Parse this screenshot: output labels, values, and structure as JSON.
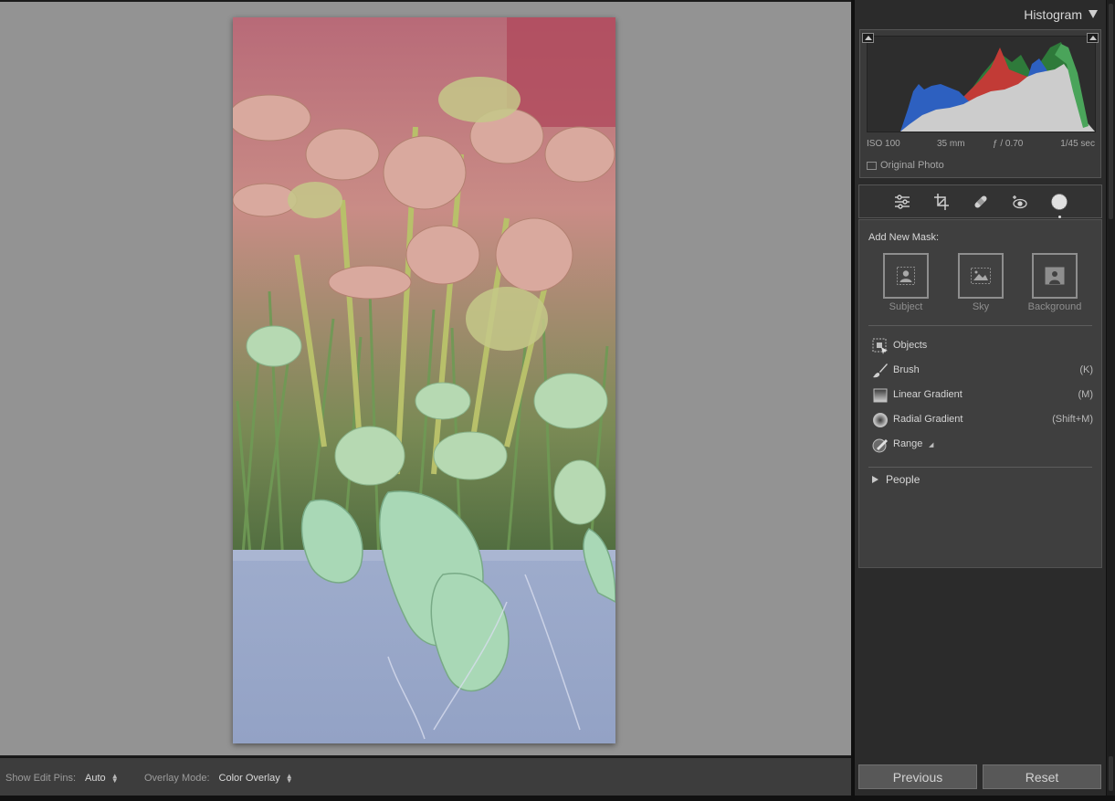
{
  "histogram": {
    "title": "Histogram",
    "exif": {
      "iso": "ISO 100",
      "focal": "35 mm",
      "aperture": "ƒ / 0.70",
      "shutter": "1/45 sec"
    },
    "original_photo_label": "Original Photo",
    "colors": {
      "red": "#d34a3c",
      "green": "#3c9a4a",
      "blue": "#2e63c2",
      "luma": "#c9c9c9"
    }
  },
  "tools": [
    {
      "name": "edit-sliders-icon"
    },
    {
      "name": "crop-icon"
    },
    {
      "name": "healing-icon"
    },
    {
      "name": "red-eye-icon"
    },
    {
      "name": "masking-icon",
      "active": true
    }
  ],
  "masking": {
    "add_label": "Add New Mask:",
    "quick": [
      {
        "label": "Subject",
        "icon": "subject-icon"
      },
      {
        "label": "Sky",
        "icon": "sky-icon"
      },
      {
        "label": "Background",
        "icon": "background-icon"
      }
    ],
    "tools": [
      {
        "label": "Objects",
        "shortcut": "",
        "icon": "objects-icon"
      },
      {
        "label": "Brush",
        "shortcut": "(K)",
        "icon": "brush-icon"
      },
      {
        "label": "Linear Gradient",
        "shortcut": "(M)",
        "icon": "linear-gradient-icon"
      },
      {
        "label": "Radial Gradient",
        "shortcut": "(Shift+M)",
        "icon": "radial-gradient-icon"
      },
      {
        "label": "Range",
        "shortcut": "",
        "icon": "range-icon"
      }
    ],
    "people_label": "People"
  },
  "toolbar": {
    "edit_pins_label": "Show Edit Pins:",
    "edit_pins_value": "Auto",
    "overlay_label": "Overlay Mode:",
    "overlay_value": "Color Overlay"
  },
  "buttons": {
    "previous": "Previous",
    "reset": "Reset"
  },
  "overlay_color": "#e05060"
}
